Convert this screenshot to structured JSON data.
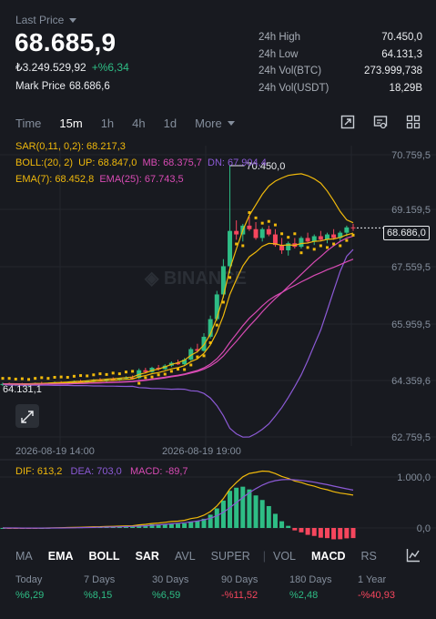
{
  "header": {
    "last_price_label": "Last Price",
    "price": "68.685,9",
    "fiat_value": "₺3.249.529,92",
    "change": "+%6,34",
    "mark_label": "Mark Price",
    "mark_value": "68.686,6"
  },
  "stats": [
    {
      "label": "24h High",
      "value": "70.450,0"
    },
    {
      "label": "24h Low",
      "value": "64.131,3"
    },
    {
      "label": "24h Vol(BTC)",
      "value": "273.999,738"
    },
    {
      "label": "24h Vol(USDT)",
      "value": "18,29B"
    }
  ],
  "timeframes": [
    "Time",
    "15m",
    "1h",
    "4h",
    "1d",
    "More"
  ],
  "active_timeframe": "15m",
  "legend": {
    "sar": "SAR(0,11, 0,2): 68.217,3",
    "boll": "BOLL:(20, 2)",
    "boll_up": "UP: 68.847,0",
    "boll_mb": "MB: 68.375,7",
    "boll_dn": "DN: 67.904,4",
    "ema7": "EMA(7): 68.452,8",
    "ema25": "EMA(25): 67.743,5",
    "dif": "DIF: 613,2",
    "dea": "DEA: 703,0",
    "macd": "MACD: -89,7"
  },
  "colors": {
    "up": "#2ebd85",
    "down": "#f6465d",
    "sar": "#f0b90b",
    "boll": "#f0b90b",
    "mb": "#d84bb4",
    "dn": "#8c5ad6",
    "ema7": "#f0b90b",
    "ema25": "#d84bb4"
  },
  "chart_data": {
    "type": "candlestick",
    "y_ticks": [
      "70.759,5",
      "69.159,5",
      "67.559,5",
      "65.959,5",
      "64.359,6",
      "62.759,5"
    ],
    "ylim": [
      62759.5,
      70759.5
    ],
    "x_ticks": [
      "2026-08-19 14:00",
      "2026-08-19 19:00"
    ],
    "current_price_tag": "68.686,0",
    "high_annotation": "70.450,0",
    "low_annotation": "64.131,1",
    "macd_ticks": [
      "1.000,0",
      "0,0"
    ],
    "candles": [
      [
        64250,
        64300,
        64200,
        64260
      ],
      [
        64260,
        64300,
        64220,
        64240
      ],
      [
        64240,
        64280,
        64200,
        64250
      ],
      [
        64250,
        64290,
        64210,
        64230
      ],
      [
        64230,
        64270,
        64180,
        64250
      ],
      [
        64250,
        64300,
        64220,
        64270
      ],
      [
        64270,
        64320,
        64240,
        64260
      ],
      [
        64260,
        64300,
        64220,
        64280
      ],
      [
        64280,
        64330,
        64250,
        64300
      ],
      [
        64300,
        64340,
        64260,
        64290
      ],
      [
        64290,
        64330,
        64250,
        64310
      ],
      [
        64310,
        64360,
        64280,
        64330
      ],
      [
        64330,
        64380,
        64300,
        64320
      ],
      [
        64320,
        64370,
        64290,
        64350
      ],
      [
        64350,
        64400,
        64310,
        64380
      ],
      [
        64380,
        64430,
        64340,
        64360
      ],
      [
        64360,
        64410,
        64320,
        64400
      ],
      [
        64400,
        64450,
        64360,
        64390
      ],
      [
        64390,
        64430,
        64350,
        64420
      ],
      [
        64420,
        64480,
        64390,
        64440
      ],
      [
        64440,
        64500,
        64410,
        64430
      ],
      [
        64430,
        64700,
        64400,
        64650
      ],
      [
        64650,
        64720,
        64560,
        64600
      ],
      [
        64600,
        64750,
        64580,
        64720
      ],
      [
        64720,
        64800,
        64640,
        64680
      ],
      [
        64680,
        64820,
        64660,
        64780
      ],
      [
        64780,
        64900,
        64740,
        64860
      ],
      [
        64860,
        64950,
        64800,
        64820
      ],
      [
        64820,
        65000,
        64790,
        64950
      ],
      [
        64950,
        65300,
        64920,
        65250
      ],
      [
        65250,
        65400,
        65150,
        65200
      ],
      [
        65200,
        65700,
        65180,
        65600
      ],
      [
        65600,
        66200,
        65550,
        66100
      ],
      [
        66100,
        66900,
        66050,
        66800
      ],
      [
        66800,
        67800,
        66700,
        67600
      ],
      [
        67600,
        70450,
        67400,
        68600
      ],
      [
        68600,
        68900,
        68350,
        68500
      ],
      [
        68500,
        68800,
        68300,
        68750
      ],
      [
        68750,
        69000,
        68600,
        68650
      ],
      [
        68650,
        68850,
        68350,
        68400
      ],
      [
        68400,
        68700,
        68300,
        68650
      ],
      [
        68650,
        68750,
        68450,
        68500
      ],
      [
        68500,
        68650,
        68150,
        68200
      ],
      [
        68200,
        68400,
        67950,
        68050
      ],
      [
        68050,
        68300,
        67900,
        68250
      ],
      [
        68250,
        68400,
        68100,
        68150
      ],
      [
        68150,
        68450,
        68100,
        68400
      ],
      [
        68400,
        68550,
        68250,
        68300
      ],
      [
        68300,
        68500,
        68200,
        68450
      ],
      [
        68450,
        68600,
        68300,
        68350
      ],
      [
        68350,
        68550,
        68250,
        68500
      ],
      [
        68500,
        68650,
        68350,
        68400
      ],
      [
        68400,
        68600,
        68300,
        68550
      ],
      [
        68550,
        68750,
        68450,
        68700
      ],
      [
        68700,
        68800,
        68600,
        68686
      ]
    ]
  },
  "indicators": [
    "MA",
    "EMA",
    "BOLL",
    "SAR",
    "AVL",
    "SUPER",
    "VOL",
    "MACD",
    "RS"
  ],
  "active_indicators": [
    "EMA",
    "BOLL",
    "SAR",
    "MACD"
  ],
  "performance": [
    {
      "label": "Today",
      "value": "%6,29",
      "dir": "up"
    },
    {
      "label": "7 Days",
      "value": "%8,15",
      "dir": "up"
    },
    {
      "label": "30 Days",
      "value": "%6,59",
      "dir": "up"
    },
    {
      "label": "90 Days",
      "value": "-%11,52",
      "dir": "down"
    },
    {
      "label": "180 Days",
      "value": "%2,48",
      "dir": "up"
    },
    {
      "label": "1 Year",
      "value": "-%40,93",
      "dir": "down"
    }
  ]
}
